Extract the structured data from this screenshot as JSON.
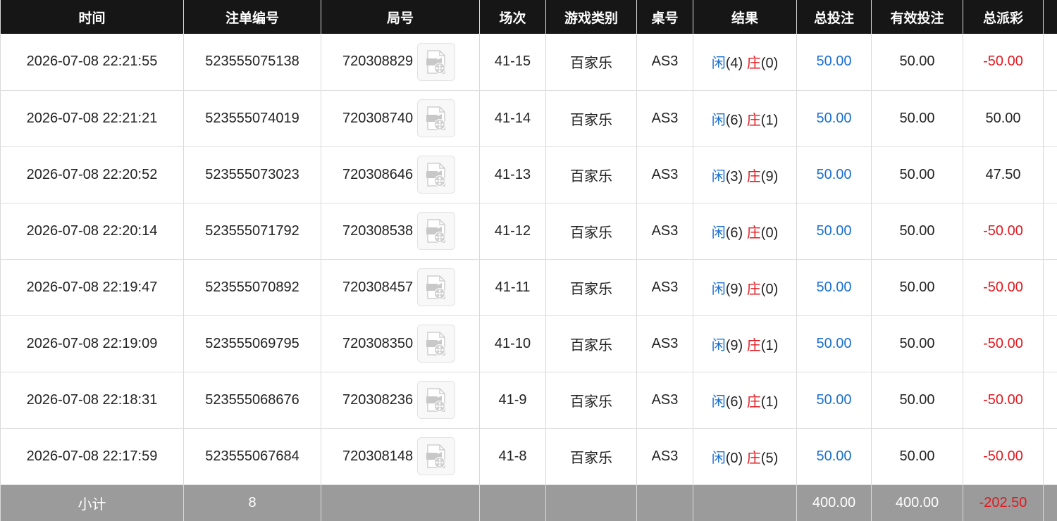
{
  "headers": [
    "时间",
    "注单编号",
    "局号",
    "场次",
    "游戏类别",
    "桌号",
    "结果",
    "总投注",
    "有效投注",
    "总派彩"
  ],
  "colors": {
    "header_bg": "#161616",
    "footer_bg": "#9b9b9b",
    "blue": "#1a6fd1",
    "red": "#e0191f"
  },
  "rows": [
    {
      "time": "2026-07-08 22:21:55",
      "bet_no": "523555075138",
      "round_no": "720308829",
      "shoe": "41-15",
      "game": "百家乐",
      "table": "AS3",
      "player_label": "闲",
      "player_score": "(4)",
      "banker_label": "庄",
      "banker_score": "(0)",
      "total_bet": "50.00",
      "valid_bet": "50.00",
      "payout": "-50.00",
      "payout_negative": true
    },
    {
      "time": "2026-07-08 22:21:21",
      "bet_no": "523555074019",
      "round_no": "720308740",
      "shoe": "41-14",
      "game": "百家乐",
      "table": "AS3",
      "player_label": "闲",
      "player_score": "(6)",
      "banker_label": "庄",
      "banker_score": "(1)",
      "total_bet": "50.00",
      "valid_bet": "50.00",
      "payout": "50.00",
      "payout_negative": false
    },
    {
      "time": "2026-07-08 22:20:52",
      "bet_no": "523555073023",
      "round_no": "720308646",
      "shoe": "41-13",
      "game": "百家乐",
      "table": "AS3",
      "player_label": "闲",
      "player_score": "(3)",
      "banker_label": "庄",
      "banker_score": "(9)",
      "total_bet": "50.00",
      "valid_bet": "50.00",
      "payout": "47.50",
      "payout_negative": false
    },
    {
      "time": "2026-07-08 22:20:14",
      "bet_no": "523555071792",
      "round_no": "720308538",
      "shoe": "41-12",
      "game": "百家乐",
      "table": "AS3",
      "player_label": "闲",
      "player_score": "(6)",
      "banker_label": "庄",
      "banker_score": "(0)",
      "total_bet": "50.00",
      "valid_bet": "50.00",
      "payout": "-50.00",
      "payout_negative": true
    },
    {
      "time": "2026-07-08 22:19:47",
      "bet_no": "523555070892",
      "round_no": "720308457",
      "shoe": "41-11",
      "game": "百家乐",
      "table": "AS3",
      "player_label": "闲",
      "player_score": "(9)",
      "banker_label": "庄",
      "banker_score": "(0)",
      "total_bet": "50.00",
      "valid_bet": "50.00",
      "payout": "-50.00",
      "payout_negative": true
    },
    {
      "time": "2026-07-08 22:19:09",
      "bet_no": "523555069795",
      "round_no": "720308350",
      "shoe": "41-10",
      "game": "百家乐",
      "table": "AS3",
      "player_label": "闲",
      "player_score": "(9)",
      "banker_label": "庄",
      "banker_score": "(1)",
      "total_bet": "50.00",
      "valid_bet": "50.00",
      "payout": "-50.00",
      "payout_negative": true
    },
    {
      "time": "2026-07-08 22:18:31",
      "bet_no": "523555068676",
      "round_no": "720308236",
      "shoe": "41-9",
      "game": "百家乐",
      "table": "AS3",
      "player_label": "闲",
      "player_score": "(6)",
      "banker_label": "庄",
      "banker_score": "(1)",
      "total_bet": "50.00",
      "valid_bet": "50.00",
      "payout": "-50.00",
      "payout_negative": true
    },
    {
      "time": "2026-07-08 22:17:59",
      "bet_no": "523555067684",
      "round_no": "720308148",
      "shoe": "41-8",
      "game": "百家乐",
      "table": "AS3",
      "player_label": "闲",
      "player_score": "(0)",
      "banker_label": "庄",
      "banker_score": "(5)",
      "total_bet": "50.00",
      "valid_bet": "50.00",
      "payout": "-50.00",
      "payout_negative": true
    }
  ],
  "row_icon": "video-replay-icon",
  "subtotal": {
    "label": "小计",
    "count": "8",
    "total_bet": "400.00",
    "valid_bet": "400.00",
    "payout": "-202.50"
  }
}
